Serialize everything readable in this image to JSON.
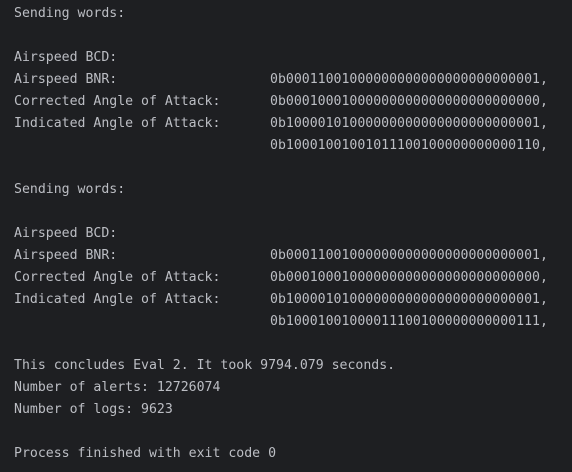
{
  "blocks": [
    {
      "header": "Sending words:",
      "rows": [
        {
          "label": "Airspeed BCD:",
          "value": "0b00011001000000000000000000000001,"
        },
        {
          "label": "Airspeed BNR:",
          "value": "0b00010001000000000000000000000000,"
        },
        {
          "label": "Corrected Angle of Attack:",
          "value": "0b10000101000000000000000000000001,"
        },
        {
          "label": "Indicated Angle of Attack:",
          "value": "0b10001001001011100100000000000110,"
        }
      ]
    },
    {
      "header": "Sending words:",
      "rows": [
        {
          "label": "Airspeed BCD:",
          "value": "0b00011001000000000000000000000001,"
        },
        {
          "label": "Airspeed BNR:",
          "value": "0b00010001000000000000000000000000,"
        },
        {
          "label": "Corrected Angle of Attack:",
          "value": "0b10000101000000000000000000000001,"
        },
        {
          "label": "Indicated Angle of Attack:",
          "value": "0b10001001000011100100000000000111,"
        }
      ]
    }
  ],
  "summary": {
    "conclusion": "This concludes Eval 2. It took 9794.079 seconds.",
    "alerts": "Number of alerts: 12726074",
    "logs": "Number of logs: 9623"
  },
  "exit_message": "Process finished with exit code 0",
  "colors": {
    "background": "#1e1f22",
    "text": "#bcbec4"
  }
}
